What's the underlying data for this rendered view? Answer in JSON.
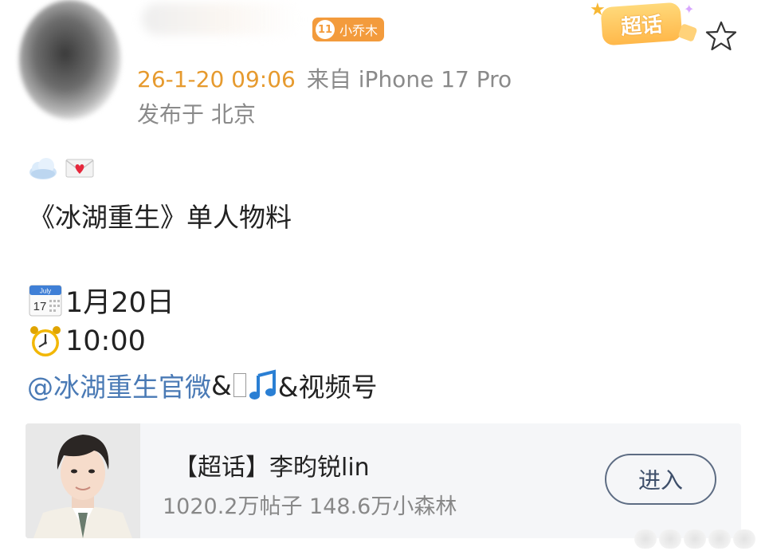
{
  "header": {
    "badge_label": "小乔木",
    "badge_icon_text": "11",
    "supertopic_tag": "超话",
    "post_time": "26-1-20 09:06",
    "source": "来自 iPhone 17 Pro",
    "location": "发布于 北京"
  },
  "post": {
    "title": "《冰湖重生》单人物料",
    "date": "1月20日",
    "time": "10:00",
    "mention": "@冰湖重生官微",
    "mention_suffix_1": " &",
    "mention_suffix_2": "&视频号"
  },
  "card": {
    "title": "【超话】李昀锐lin",
    "stats": "1020.2万帖子 148.6万小森林",
    "enter_label": "进入"
  },
  "colors": {
    "time_orange": "#e69a2e",
    "meta_gray": "#8a8a8a",
    "mention_blue": "#4a7ab5",
    "badge_orange": "#f39b3c"
  },
  "icons": [
    "cloud-emoji-icon",
    "love-letter-emoji-icon",
    "calendar-emoji-icon",
    "alarm-clock-emoji-icon",
    "music-note-emoji-icon",
    "star-icon"
  ]
}
